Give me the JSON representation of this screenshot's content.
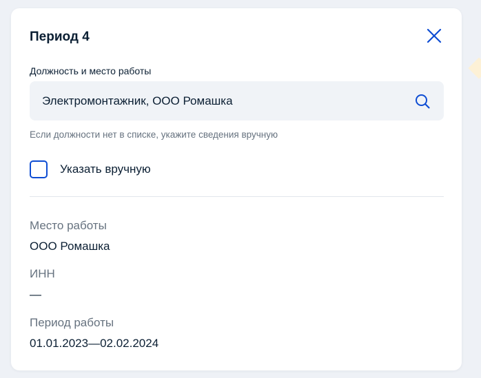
{
  "modal": {
    "title": "Период 4"
  },
  "position_field": {
    "label": "Должность и место работы",
    "value": "Электромонтажник, ООО Ромашка",
    "hint": "Если должности нет в списке, укажите сведения вручную"
  },
  "manual_checkbox": {
    "label": "Указать вручную",
    "checked": false
  },
  "details": {
    "workplace_label": "Место работы",
    "workplace_value": "ООО Ромашка",
    "inn_label": "ИНН",
    "inn_value": "—",
    "period_label": "Период работы",
    "period_value": "01.01.2023—02.02.2024"
  },
  "colors": {
    "accent": "#0d4cd3",
    "text": "#0b1f33",
    "muted": "#66727f",
    "field_bg": "#f0f3f7",
    "page_bg": "#eef1f6"
  },
  "icons": {
    "close": "close-icon",
    "search": "search-icon"
  }
}
